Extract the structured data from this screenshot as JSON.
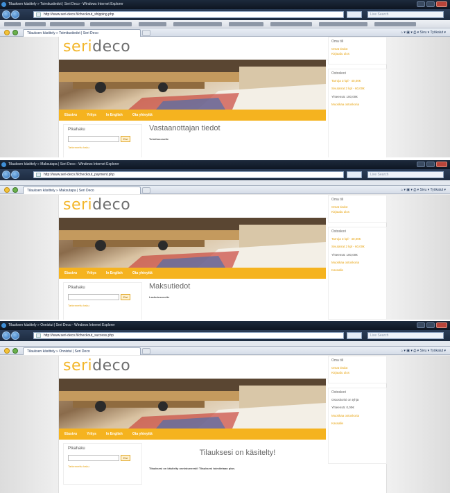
{
  "shots": [
    {
      "window_title": "Tilauksen käsittely » Toimitustiedot | Seri Deco - Windows Internet Explorer",
      "url": "http://www.seri-deco.fi/checkout_shipping.php",
      "tab": "Tilauksen käsittely » Toimitustiedot | Seri Deco",
      "heading": "Vastaanottajan tiedot",
      "subheading": "Toimitusosoite",
      "cart_items": [
        "Tarroja 3 kpl - 40,00€",
        "Sivutarrat 2 kpl - 60,00€"
      ],
      "total": "Yhteensä: 100,00€"
    },
    {
      "window_title": "Tilauksen käsittely » Maksutapa | Seri Deco - Windows Internet Explorer",
      "url": "http://www.seri-deco.fi/checkout_payment.php",
      "tab": "Tilauksen käsittely » Maksutapa | Seri Deco",
      "heading": "Maksutiedot",
      "subheading": "Laskutusosoite",
      "cart_items": [
        "Tarroja 3 kpl - 40,00€",
        "Sivutarrat 2 kpl - 60,00€"
      ],
      "total": "Yhteensä: 100,00€"
    },
    {
      "window_title": "Tilauksen käsittely » Onnistui | Seri Deco - Windows Internet Explorer",
      "url": "http://www.seri-deco.fi/checkout_success.php",
      "tab": "Tilauksen käsittely » Onnistui | Seri Deco",
      "heading": "Tilauksesi on käsitelty!",
      "note": "Tilauksesi on käsitelty onnistuneesti! Tilauksesi toimitetaan pian.",
      "cart_empty": "Ostoskorisi on tyhjä",
      "total": "Yhteensä: 0,00€"
    }
  ],
  "browser": {
    "search_placeholder": "Live Search",
    "commands": "⌂ ▾ ▣ ▾ ⎙ ▾ Sivu ▾ Työkalut ▾"
  },
  "site": {
    "logo_part1": "seri",
    "logo_part2": "deco",
    "nav": [
      "Etusivu",
      "Yritys",
      "In English",
      "Ota yhteyttä"
    ],
    "search_title": "Pikahaku",
    "search_button": "Etsi",
    "advanced_search": "Tarkennettu haku",
    "account_title": "Oma tili",
    "account_links": [
      "Omat tiedot",
      "Kirjaudu ulos"
    ],
    "cart_title": "Ostoskori",
    "cart_links": [
      "Muokkaa ostoskoria",
      "Kassalle"
    ]
  },
  "colors": {
    "accent": "#f5b31f",
    "logo_gray": "#6e6e6e",
    "link": "#e7a20c"
  }
}
